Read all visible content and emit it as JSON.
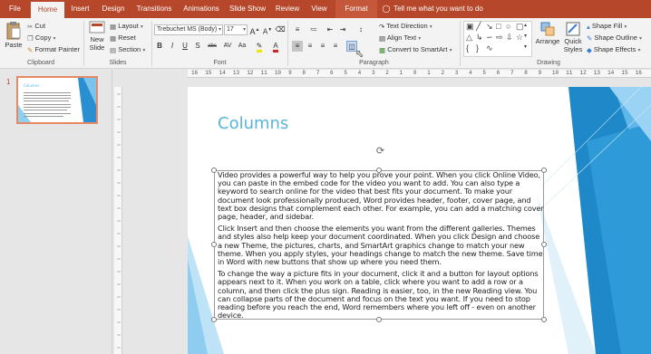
{
  "tabs": [
    {
      "label": "File",
      "active": false
    },
    {
      "label": "Home",
      "active": true
    },
    {
      "label": "Insert",
      "active": false
    },
    {
      "label": "Design",
      "active": false
    },
    {
      "label": "Transitions",
      "active": false
    },
    {
      "label": "Animations",
      "active": false
    },
    {
      "label": "Slide Show",
      "active": false
    },
    {
      "label": "Review",
      "active": false
    },
    {
      "label": "View",
      "active": false
    },
    {
      "label": "Format",
      "active": false
    }
  ],
  "tell_me": "Tell me what you want to do",
  "ribbon": {
    "clipboard": {
      "paste": "Paste",
      "cut": "Cut",
      "copy": "Copy",
      "format_painter": "Format Painter",
      "group": "Clipboard"
    },
    "slides": {
      "new_slide_line1": "New",
      "new_slide_line2": "Slide",
      "layout": "Layout",
      "reset": "Reset",
      "section": "Section",
      "group": "Slides"
    },
    "font": {
      "font_name": "Trebuchet MS (Body)",
      "font_size": "17",
      "bold": "B",
      "italic": "I",
      "underline": "U",
      "shadow": "S",
      "strike": "abc",
      "group": "Font"
    },
    "paragraph": {
      "text_direction": "Text Direction",
      "align_text": "Align Text",
      "convert_smartart": "Convert to SmartArt",
      "group": "Paragraph"
    },
    "drawing": {
      "arrange": "Arrange",
      "quick_styles_line1": "Quick",
      "quick_styles_line2": "Styles",
      "shape_fill": "Shape Fill",
      "shape_outline": "Shape Outline",
      "shape_effects": "Shape Effects",
      "group": "Drawing"
    }
  },
  "thumbnail": {
    "number": "1"
  },
  "slide": {
    "title": "Columns",
    "paragraphs": [
      "Video provides a powerful way to help you prove your point. When you click Online Video, you can paste in the embed code for the video you want to add. You can also type a keyword to search online for the video that best fits your document. To make your document look professionally produced, Word provides header, footer, cover page, and text box designs that complement each other. For example, you can add a matching cover page, header, and sidebar.",
      "Click Insert and then choose the elements you want from the different galleries. Themes and styles also help keep your document coordinated. When you click Design and choose a new Theme, the pictures, charts, and SmartArt graphics change to match your new theme. When you apply styles, your headings change to match the new theme. Save time in Word with new buttons that show up where you need them.",
      "To change the way a picture fits in your document, click it and a button for layout options appears next to it. When you work on a table, click where you want to add a row or a column, and then click the plus sign. Reading is easier, too, in the new Reading view. You can collapse parts of the document and focus on the text you want. If you need to stop reading before you reach the end, Word remembers where you left off - even on another device."
    ]
  },
  "ruler": {
    "h_ticks": [
      "16",
      "15",
      "14",
      "13",
      "12",
      "11",
      "10",
      "9",
      "8",
      "7",
      "6",
      "5",
      "4",
      "3",
      "2",
      "1",
      "0",
      "1",
      "2",
      "3",
      "4",
      "5",
      "6",
      "7",
      "8",
      "9",
      "10",
      "11",
      "12",
      "13",
      "14",
      "15",
      "16"
    ]
  },
  "colors": {
    "accent": "#b7472a",
    "title": "#5ab4d9",
    "decor_blue": "#1e88c8"
  }
}
